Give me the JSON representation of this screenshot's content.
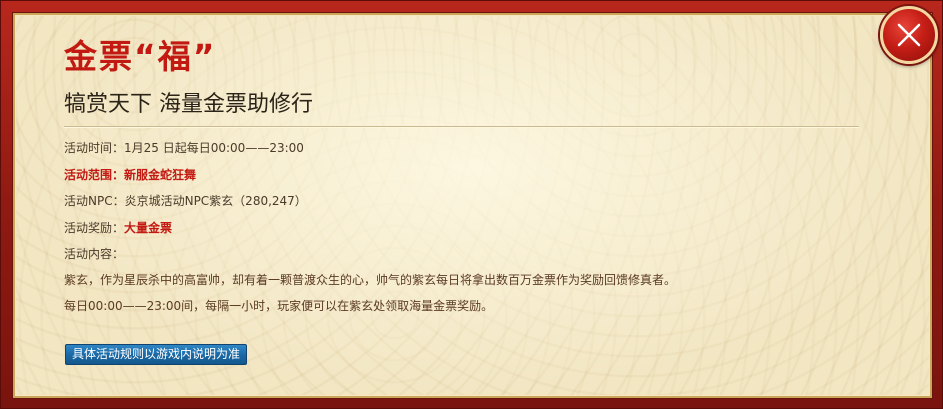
{
  "header": {
    "title": "金票“福”",
    "subtitle": "犒赏天下 海量金票助修行"
  },
  "details": {
    "time_label": "活动时间：",
    "time_value": "1月25 日起每日00:00——23:00",
    "scope_text": "活动范围：新服金蛇狂舞",
    "npc_label": "活动NPC：",
    "npc_value": "炎京城活动NPC紫玄（280,247）",
    "reward_label": "活动奖励：",
    "reward_value": "大量金票",
    "content_label": "活动内容：",
    "content_line1": "紫玄，作为星辰杀中的高富帅，却有着一颗普渡众生的心，帅气的紫玄每日将拿出数百万金票作为奖励回馈修真者。",
    "content_line2": "每日00:00——23:00间，每隔一小时，玩家便可以在紫玄处领取海量金票奖励。"
  },
  "footer": {
    "rules_button": "具体活动规则以游戏内说明为准"
  },
  "icons": {
    "close": "close-icon"
  },
  "colors": {
    "accent_red": "#c21a12",
    "button_blue": "#1a6aa8",
    "panel_bg": "#f2e6c3",
    "frame_red": "#8f1a12"
  }
}
